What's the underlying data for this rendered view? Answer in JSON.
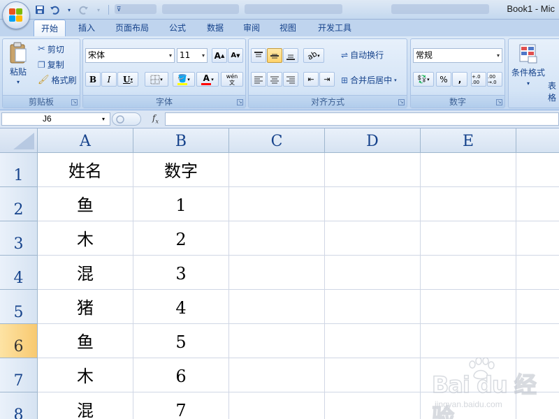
{
  "window": {
    "title": "Book1 - Mic"
  },
  "qat": {
    "items": [
      "save-icon",
      "undo-icon",
      "redo-icon",
      "customize-icon"
    ]
  },
  "tabs": [
    {
      "label": "开始",
      "active": true
    },
    {
      "label": "插入",
      "active": false
    },
    {
      "label": "页面布局",
      "active": false
    },
    {
      "label": "公式",
      "active": false
    },
    {
      "label": "数据",
      "active": false
    },
    {
      "label": "审阅",
      "active": false
    },
    {
      "label": "视图",
      "active": false
    },
    {
      "label": "开发工具",
      "active": false
    }
  ],
  "ribbon": {
    "clipboard": {
      "label": "剪贴板",
      "paste": "粘贴",
      "cut": "剪切",
      "copy": "复制",
      "format_painter": "格式刷"
    },
    "font": {
      "label": "字体",
      "font_name": "宋体",
      "font_size": "11",
      "bold": "B",
      "italic": "I",
      "underline": "U",
      "grow": "A",
      "shrink": "A",
      "font_color": "A",
      "phonetic": "wén 文"
    },
    "alignment": {
      "label": "对齐方式",
      "wrap_text": "自动换行",
      "merge_center": "合并后居中"
    },
    "number": {
      "label": "数字",
      "format": "常规",
      "percent": "%",
      "comma": ",",
      "increase_decimal": "+.0 .00",
      "decrease_decimal": ".00 →.0"
    },
    "styles": {
      "conditional_format": "条件格式",
      "table_fragment": "表格"
    }
  },
  "formula_bar": {
    "name_box": "J6",
    "fx": "fx",
    "formula": ""
  },
  "sheet": {
    "columns": [
      "A",
      "B",
      "C",
      "D",
      "E"
    ],
    "rows": [
      "1",
      "2",
      "3",
      "4",
      "5",
      "6",
      "7",
      "8"
    ],
    "selected_row": "6",
    "cells": [
      [
        "姓名",
        "数字"
      ],
      [
        "鱼",
        "1"
      ],
      [
        "木",
        "2"
      ],
      [
        "混",
        "3"
      ],
      [
        "猪",
        "4"
      ],
      [
        "鱼",
        "5"
      ],
      [
        "木",
        "6"
      ],
      [
        "混",
        "7"
      ]
    ]
  },
  "watermark": {
    "logo": "Bai du 经验",
    "url": "jingyan.baidu.com"
  },
  "colors": {
    "ribbon_bg": "#c9dcf2",
    "header_text": "#15428b",
    "selected_row_header": "#f8c970"
  }
}
